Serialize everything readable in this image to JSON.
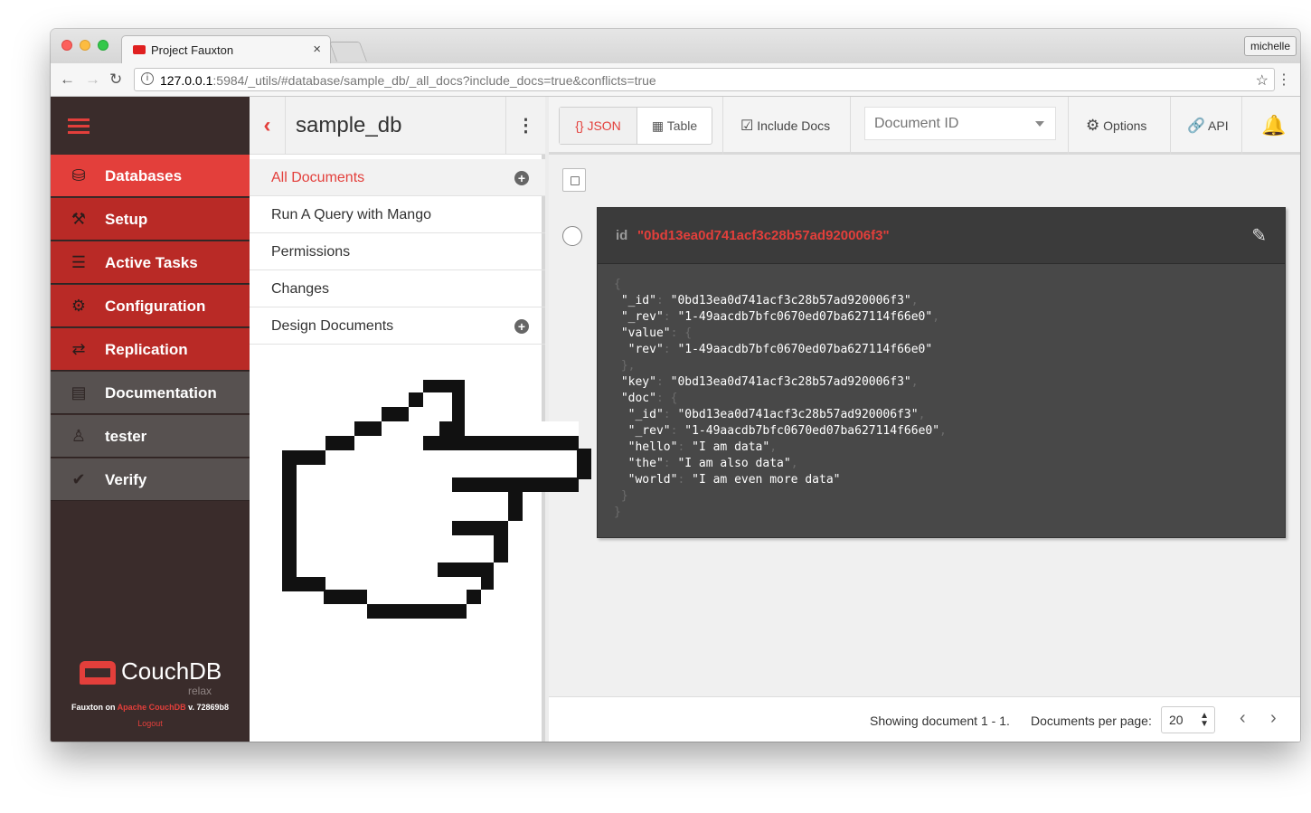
{
  "browser": {
    "tab_title": "Project Fauxton",
    "tab_close": "×",
    "profile": "michelle",
    "url_host": "127.0.0.1",
    "url_rest": ":5984/_utils/#database/sample_db/_all_docs?include_docs=true&conflicts=true",
    "nav_icons": [
      "back-arrow-icon",
      "forward-arrow-icon",
      "reload-icon",
      "info-icon",
      "star-icon",
      "menu-icon"
    ]
  },
  "sidebar": {
    "items": [
      {
        "label": "Databases",
        "icon": "database-icon"
      },
      {
        "label": "Setup",
        "icon": "wrench-icon"
      },
      {
        "label": "Active Tasks",
        "icon": "tasks-icon"
      },
      {
        "label": "Configuration",
        "icon": "gear-icon"
      },
      {
        "label": "Replication",
        "icon": "replication-icon"
      },
      {
        "label": "Documentation",
        "icon": "book-icon"
      },
      {
        "label": "tester",
        "icon": "user-icon"
      },
      {
        "label": "Verify",
        "icon": "check-icon"
      }
    ],
    "logo_text": "CouchDB",
    "logo_tagline": "relax",
    "footer_prefix": "Fauxton on",
    "footer_link": "Apache CouchDB",
    "footer_version": "v. 72869b8",
    "logout": "Logout"
  },
  "db": {
    "name": "sample_db",
    "menu": [
      "All Documents",
      "Run A Query with Mango",
      "Permissions",
      "Changes",
      "Design Documents"
    ]
  },
  "toolbar": {
    "json": "{} JSON",
    "table": "Table",
    "include_docs": "Include Docs",
    "docid_placeholder": "Document ID",
    "options": "Options",
    "api": "API"
  },
  "document": {
    "id_key": "id",
    "id_value": "\"0bd13ea0d741acf3c28b57ad920006f3\"",
    "_id": "0bd13ea0d741acf3c28b57ad920006f3",
    "_rev": "1-49aacdb7bfc0670ed07ba627114f66e0",
    "value_rev": "1-49aacdb7bfc0670ed07ba627114f66e0",
    "key": "0bd13ea0d741acf3c28b57ad920006f3",
    "doc_id": "0bd13ea0d741acf3c28b57ad920006f3",
    "doc_rev": "1-49aacdb7bfc0670ed07ba627114f66e0",
    "hello": "I am data",
    "the": "I am also data",
    "world": "I am even more data"
  },
  "pager": {
    "showing": "Showing document 1 - 1.",
    "per_page_label": "Documents per page:",
    "per_page_value": "20"
  }
}
